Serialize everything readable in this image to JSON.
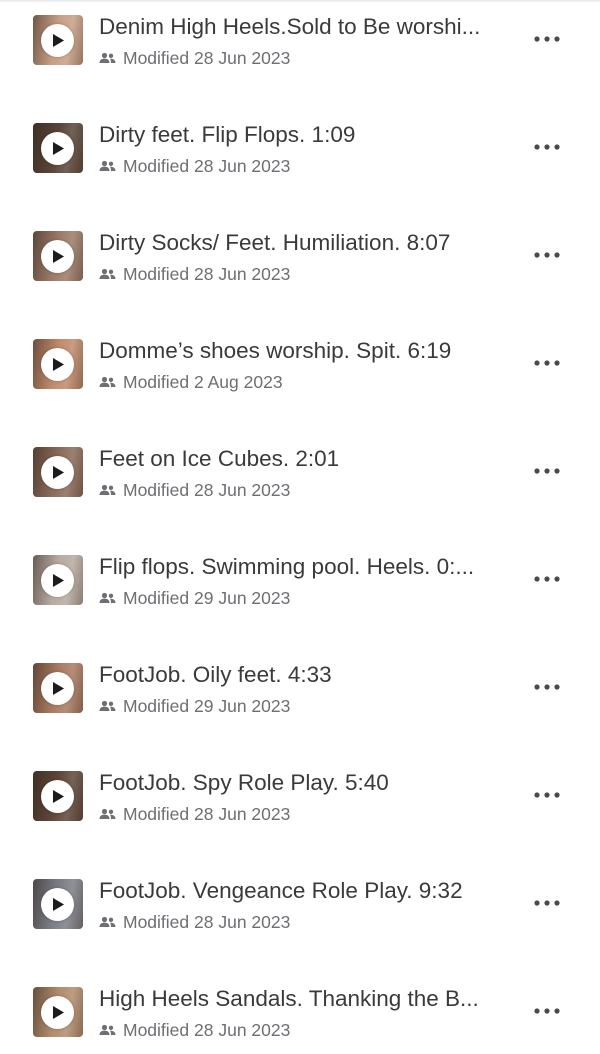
{
  "files": [
    {
      "title": "Denim High Heels.Sold to Be worshi...",
      "modified": "Modified 28 Jun 2023",
      "thumbnail_icon": "video-thumbnail",
      "play_icon": "play-icon",
      "shared_icon": "people-icon",
      "more_icon": "more-horizontal-icon"
    },
    {
      "title": "Dirty feet. Flip Flops. 1:09",
      "modified": "Modified 28 Jun 2023",
      "thumbnail_icon": "video-thumbnail",
      "play_icon": "play-icon",
      "shared_icon": "people-icon",
      "more_icon": "more-horizontal-icon"
    },
    {
      "title": "Dirty Socks/ Feet. Humiliation. 8:07",
      "modified": "Modified 28 Jun 2023",
      "thumbnail_icon": "video-thumbnail",
      "play_icon": "play-icon",
      "shared_icon": "people-icon",
      "more_icon": "more-horizontal-icon"
    },
    {
      "title": "Domme’s shoes worship. Spit. 6:19",
      "modified": "Modified 2 Aug 2023",
      "thumbnail_icon": "video-thumbnail",
      "play_icon": "play-icon",
      "shared_icon": "people-icon",
      "more_icon": "more-horizontal-icon"
    },
    {
      "title": "Feet on Ice Cubes. 2:01",
      "modified": "Modified 28 Jun 2023",
      "thumbnail_icon": "video-thumbnail",
      "play_icon": "play-icon",
      "shared_icon": "people-icon",
      "more_icon": "more-horizontal-icon"
    },
    {
      "title": "Flip flops. Swimming pool. Heels. 0:...",
      "modified": "Modified 29 Jun 2023",
      "thumbnail_icon": "video-thumbnail",
      "play_icon": "play-icon",
      "shared_icon": "people-icon",
      "more_icon": "more-horizontal-icon"
    },
    {
      "title": "FootJob. Oily feet. 4:33",
      "modified": "Modified 29 Jun 2023",
      "thumbnail_icon": "video-thumbnail",
      "play_icon": "play-icon",
      "shared_icon": "people-icon",
      "more_icon": "more-horizontal-icon"
    },
    {
      "title": "FootJob. Spy Role Play. 5:40",
      "modified": "Modified 28 Jun 2023",
      "thumbnail_icon": "video-thumbnail",
      "play_icon": "play-icon",
      "shared_icon": "people-icon",
      "more_icon": "more-horizontal-icon"
    },
    {
      "title": "FootJob. Vengeance Role Play. 9:32",
      "modified": "Modified 28 Jun 2023",
      "thumbnail_icon": "video-thumbnail",
      "play_icon": "play-icon",
      "shared_icon": "people-icon",
      "more_icon": "more-horizontal-icon"
    },
    {
      "title": "High Heels Sandals. Thanking the B...",
      "modified": "Modified 28 Jun 2023",
      "thumbnail_icon": "video-thumbnail",
      "play_icon": "play-icon",
      "shared_icon": "people-icon",
      "more_icon": "more-horizontal-icon"
    }
  ],
  "colors": {
    "title_text": "#3a3a3c",
    "meta_text": "#6e6e73",
    "icon_gray": "#6e6e73",
    "more_icon": "#4a4a4c",
    "background": "#ffffff"
  }
}
